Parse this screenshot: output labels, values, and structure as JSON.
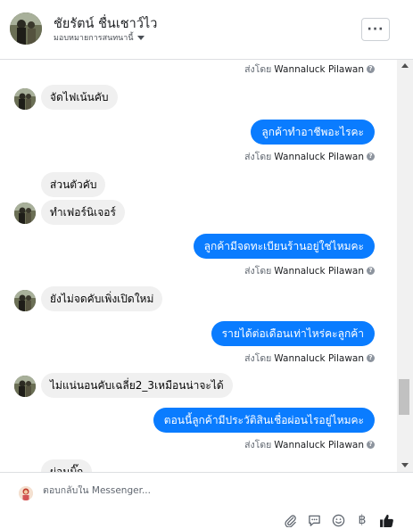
{
  "header": {
    "contact_name": "ชัยรัตน์ ชื่นเชาว์ไว",
    "assign_label": "มอบหมายการสนทนานี้",
    "more_label": "···"
  },
  "messages": [
    {
      "kind": "sent_by",
      "prefix": "ส่งโดย",
      "sender": "Wannaluck Pilawan"
    },
    {
      "kind": "in",
      "text": "จัดไฟเน้นคับ"
    },
    {
      "kind": "out",
      "text": "ลูกค้าทำอาชีพอะไรคะ"
    },
    {
      "kind": "sent_by",
      "prefix": "ส่งโดย",
      "sender": "Wannaluck Pilawan"
    },
    {
      "kind": "in",
      "text": "ส่วนตัวคับ"
    },
    {
      "kind": "in",
      "text": "ทำเฟอร์นิเจอร์"
    },
    {
      "kind": "out",
      "text": "ลูกค้ามีจดทะเบียนร้านอยู่ใช่ไหมคะ"
    },
    {
      "kind": "sent_by",
      "prefix": "ส่งโดย",
      "sender": "Wannaluck Pilawan"
    },
    {
      "kind": "in",
      "text": "ยังไม่จดคับเพิ่งเปิดใหม่"
    },
    {
      "kind": "out",
      "text": "รายได้ต่อเดือนเท่าไหร่คะลูกค้า"
    },
    {
      "kind": "sent_by",
      "prefix": "ส่งโดย",
      "sender": "Wannaluck Pilawan"
    },
    {
      "kind": "in",
      "text": "ไม่แน่นอนคับเฉลี่ย2_3เหมือนน่าจะได้"
    },
    {
      "kind": "out",
      "text": "ตอนนี้ลูกค้ามีประวัติสินเชื่อผ่อนไรอยู่ไหมคะ"
    },
    {
      "kind": "sent_by",
      "prefix": "ส่งโดย",
      "sender": "Wannaluck Pilawan"
    },
    {
      "kind": "in",
      "text": "ผ่อนบิ๊ก"
    }
  ],
  "composer": {
    "placeholder": "ตอบกลับใน Messenger..."
  },
  "toolbar": {
    "icons": [
      "paperclip-icon",
      "saved-reply-icon",
      "emoji-icon",
      "baht-icon",
      "like-icon"
    ],
    "baht_symbol": "฿"
  },
  "colors": {
    "outgoing_bubble": "#0a7cff",
    "incoming_bubble": "#f0f0f0",
    "like_icon": "#1c1e21"
  }
}
